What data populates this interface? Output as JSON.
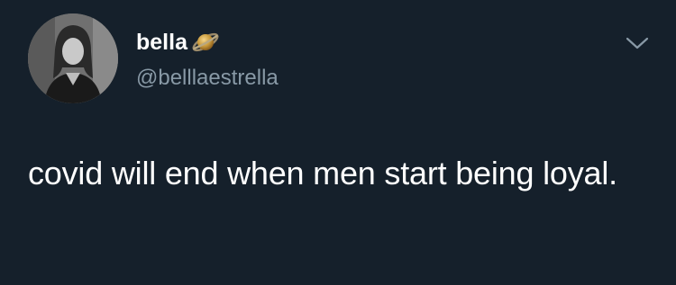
{
  "tweet": {
    "user": {
      "display_name": "bella",
      "handle": "@belllaestrella",
      "name_emoji": "ringed-planet-icon"
    },
    "text": "covid will end when men start being loyal.",
    "menu_icon": "chevron-down-icon"
  },
  "colors": {
    "background": "#15202b",
    "text": "#ffffff",
    "secondary_text": "#8899a6"
  }
}
